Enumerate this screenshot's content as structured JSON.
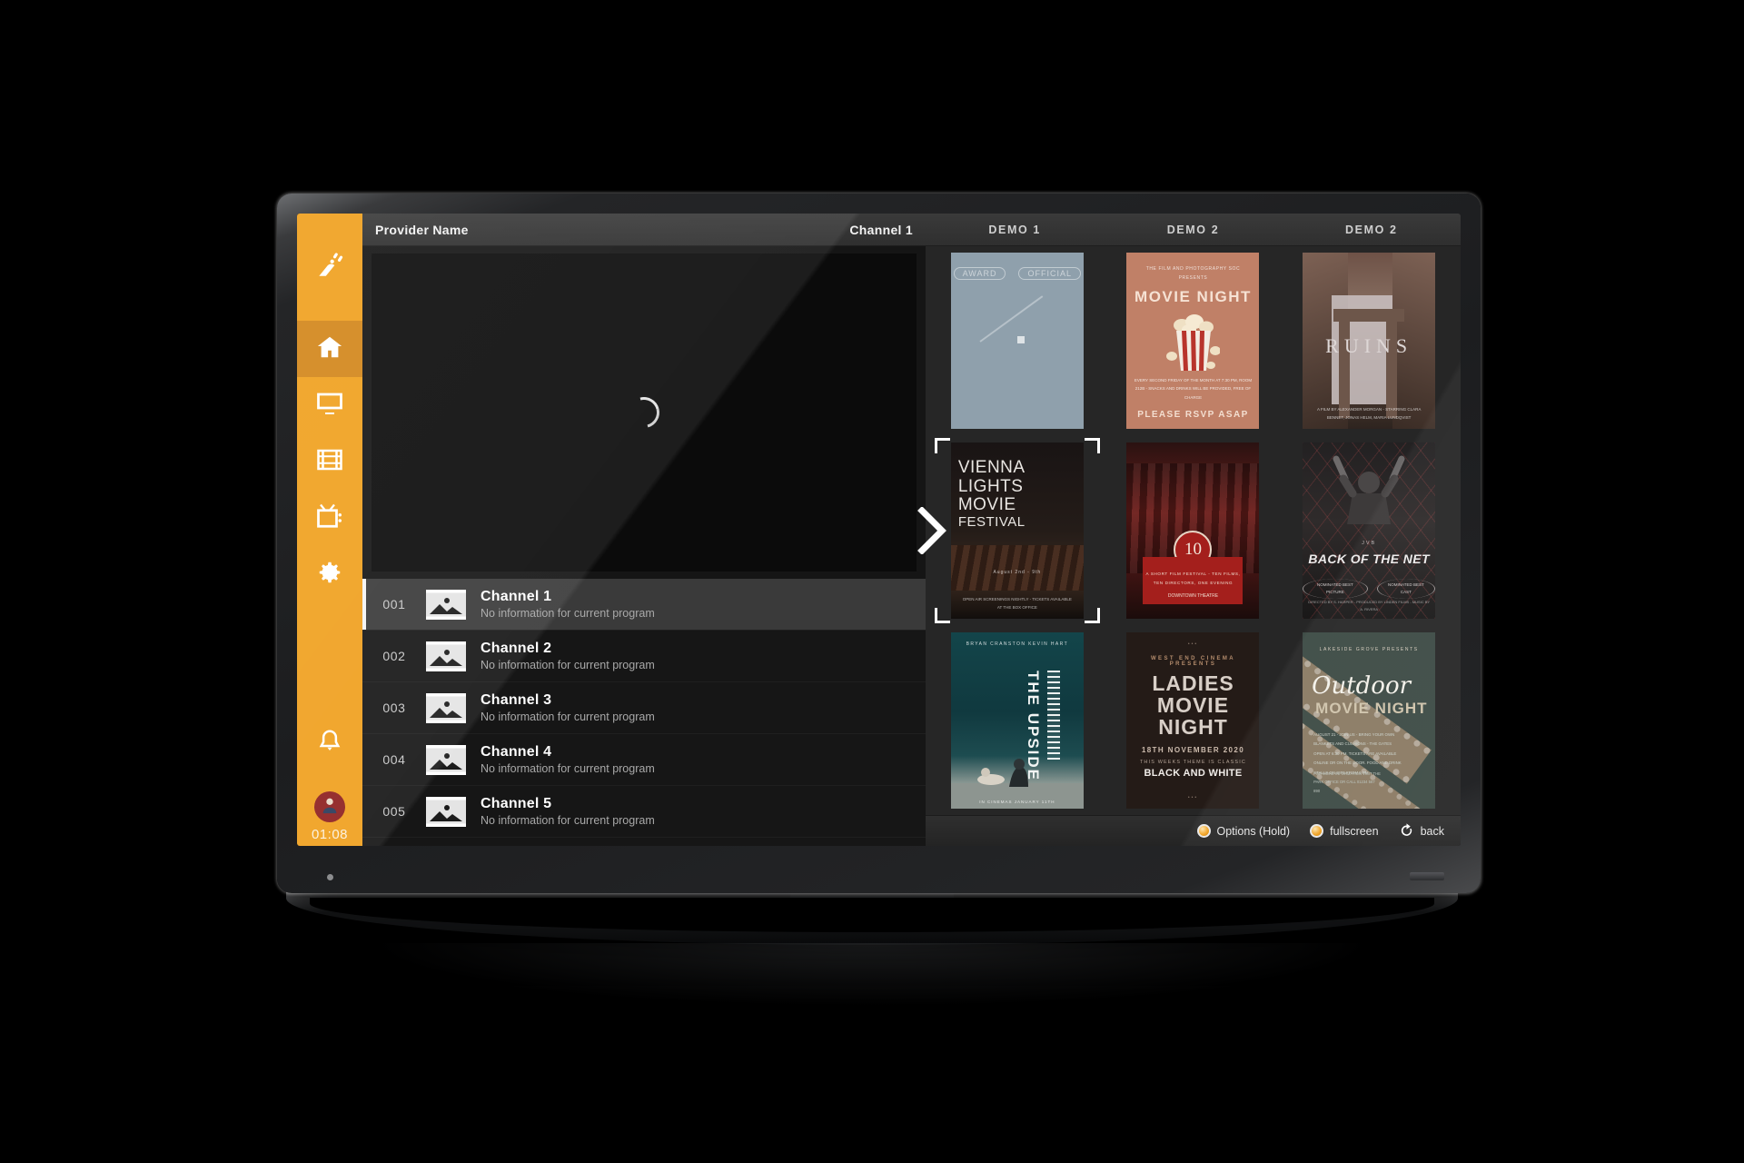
{
  "app": {
    "provider_title": "Provider Name",
    "clock": "01:08"
  },
  "sidebar": {
    "logo_icon": "satellite-dish-icon",
    "items": [
      {
        "icon": "home-icon",
        "name": "home",
        "active": true
      },
      {
        "icon": "monitor-icon",
        "name": "tv",
        "active": false
      },
      {
        "icon": "film-icon",
        "name": "movies",
        "active": false
      },
      {
        "icon": "tv-retro-icon",
        "name": "series",
        "active": false
      },
      {
        "icon": "gear-icon",
        "name": "settings",
        "active": false
      }
    ],
    "notifications_icon": "bell-icon",
    "avatar_icon": "user-avatar-icon"
  },
  "player": {
    "state_icon": "loading-spinner-icon"
  },
  "channel_list": {
    "rows": [
      {
        "number": "001",
        "name": "Channel 1",
        "program": "No information for current program",
        "selected": true,
        "thumb_icon": "image-placeholder-icon"
      },
      {
        "number": "002",
        "name": "Channel 2",
        "program": "No information for current program",
        "selected": false,
        "thumb_icon": "image-placeholder-icon"
      },
      {
        "number": "003",
        "name": "Channel 3",
        "program": "No information for current program",
        "selected": false,
        "thumb_icon": "image-placeholder-icon"
      },
      {
        "number": "004",
        "name": "Channel 4",
        "program": "No information for current program",
        "selected": false,
        "thumb_icon": "image-placeholder-icon"
      },
      {
        "number": "005",
        "name": "Channel 5",
        "program": "No information for current program",
        "selected": false,
        "thumb_icon": "image-placeholder-icon"
      }
    ]
  },
  "grid": {
    "column_headers": [
      "Channel 1",
      "DEMO 1",
      "DEMO 2",
      "DEMO 2"
    ],
    "selection_arrow_icon": "chevron-right-icon",
    "posters": [
      {
        "id": "blue-placeholder",
        "style": "p-blue",
        "badge_left": "AWARD",
        "badge_right": "OFFICIAL"
      },
      {
        "id": "movie-night",
        "style": "p-movienight",
        "kicker_1": "THE FILM AND PHOTOGRAPHY SOC",
        "kicker_2": "PRESENTS",
        "title": "MOVIE NIGHT",
        "body": "EVERY SECOND FRIDAY OF THE MONTH AT 7:30 PM, ROOM 212B  -  SNACKS AND DRINKS WILL BE PROVIDED, FREE OF CHARGE",
        "footer": "PLEASE RSVP ASAP"
      },
      {
        "id": "ruins",
        "style": "p-ruins",
        "title": "RUINS",
        "credits": "A FILM BY ALEXANDER MORGAN  -  STARRING CLARA BENNET, JONAS HELM, MARIA LUNDQVIST"
      },
      {
        "id": "vienna-lights",
        "style": "p-vienna",
        "title_lines": [
          "VIENNA",
          "LIGHTS",
          "MOVIE",
          "FESTIVAL"
        ],
        "date": "August 2nd - 9th",
        "credits": "OPEN AIR SCREENINGS NIGHTLY  -  TICKETS AVAILABLE AT THE BOX OFFICE",
        "selected": true
      },
      {
        "id": "cinema-ten",
        "style": "p-cinema",
        "badge": "10",
        "plate_text": "A SHORT FILM FESTIVAL  -  TEN FILMS, TEN DIRECTORS, ONE EVENING",
        "plate_sub": "DOWNTOWN THEATRE"
      },
      {
        "id": "back-of-the-net",
        "style": "p-net",
        "kicker": "JVB",
        "title": "BACK OF THE NET",
        "laurel_left": "NOMINATED BEST PICTURE",
        "laurel_right": "NOMINATED BEST CAST",
        "credits": "DIRECTED BY S. HARPER  -  PRODUCED BY LINDEN FILMS  -  MUSIC BY A. RIVERA"
      },
      {
        "id": "the-upside",
        "style": "p-upside",
        "header": "BRYAN CRANSTON      KEVIN HART",
        "title": "THE UPSIDE",
        "footer": "IN CINEMAS JANUARY 11TH"
      },
      {
        "id": "ladies-movie-night",
        "style": "p-ladies",
        "top_mark": "•••",
        "presents": "WEST END CINEMA PRESENTS",
        "title_lines": [
          "LADIES",
          "MOVIE",
          "NIGHT"
        ],
        "date": "18TH NOVEMBER 2020",
        "theme_label": "THIS WEEKS THEME IS CLASSIC",
        "theme_value": "BLACK AND WHITE",
        "bottom_mark": "•••"
      },
      {
        "id": "outdoor-movie-night",
        "style": "p-outdoor",
        "presents": "LAKESIDE GROVE PRESENTS",
        "title_script": "Outdoor",
        "title_sub": "MOVIE NIGHT",
        "body": "AUGUST 21  -  JOIN US  -  BRING YOUR OWN BLANKETS AND CUSHIONS  -  THE GATES OPEN AT 6:30 PM.  TICKETS ARE AVAILABLE ONLINE OR ON THE DOOR.  FOOD AND DRINK STALLS ON SITE FROM 5 PM.",
        "body2": "FOR MORE INFORMATION VISIT THE PARK OFFICE OR CALL 01234 567 890"
      }
    ]
  },
  "actionbar": {
    "items": [
      {
        "icon": "round-button-icon",
        "label": "Options (Hold)"
      },
      {
        "icon": "round-button-icon",
        "label": "fullscreen"
      },
      {
        "icon": "back-arrow-icon",
        "label": "back"
      }
    ]
  },
  "colors": {
    "accent": "#f0a01e",
    "accent_active": "#d2861a",
    "screen_bg": "#1b1b1b",
    "panel_bg": "#262626",
    "row_selected": "#3a3a3a"
  }
}
